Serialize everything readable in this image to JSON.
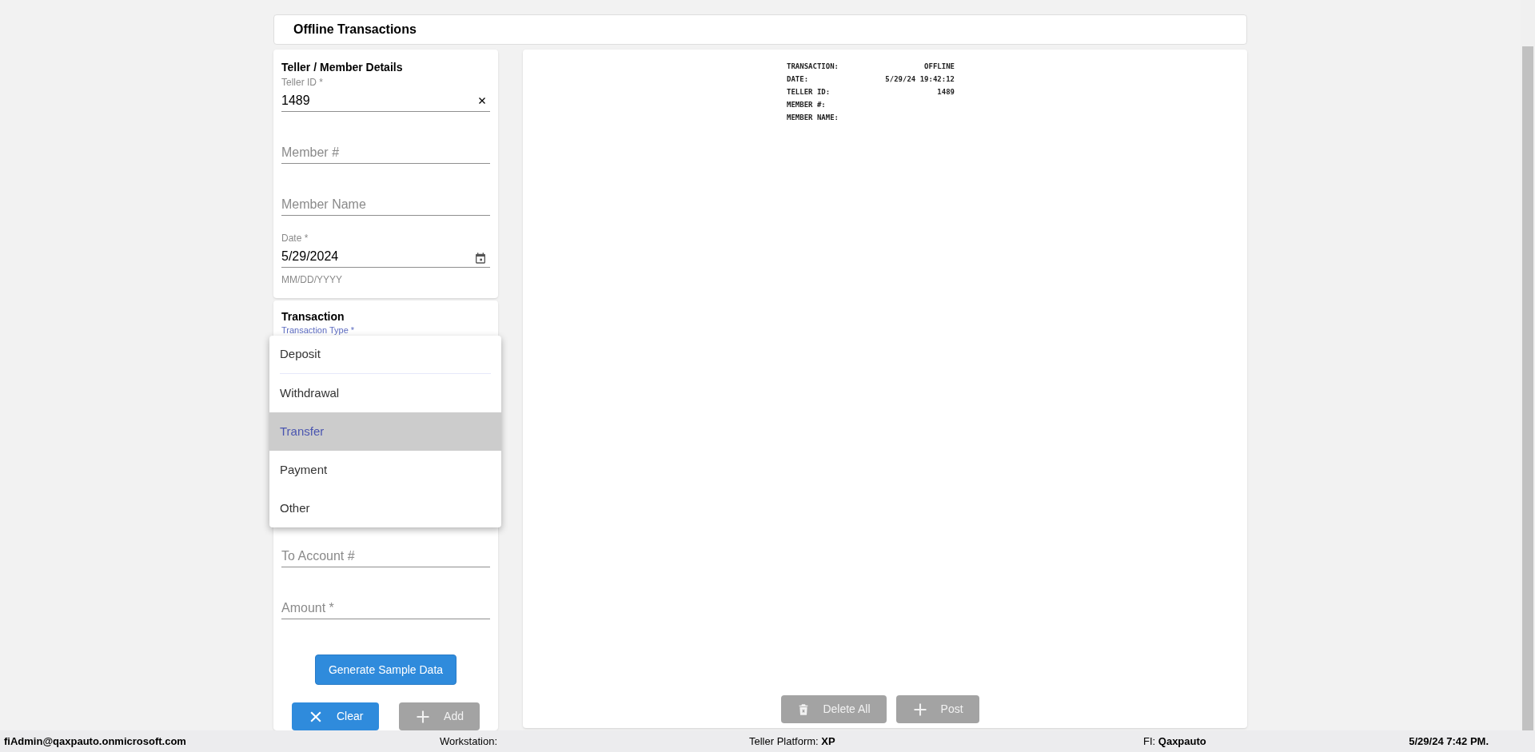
{
  "page_title": "Offline Transactions",
  "teller_member_details": {
    "title": "Teller / Member Details",
    "fields": [
      {
        "kind": "clearable",
        "label": "Teller ID *",
        "value": "1489"
      },
      {
        "kind": "plain",
        "placeholder": "Member #"
      },
      {
        "kind": "plain",
        "placeholder": "Member Name"
      },
      {
        "kind": "date",
        "label": "Date *",
        "value": "5/29/2024",
        "helper": "MM/DD/YYYY"
      }
    ]
  },
  "transaction": {
    "title": "Transaction",
    "type_label": "Transaction Type *",
    "menu": [
      {
        "label": "Deposit",
        "selected": false
      },
      {
        "label": "Withdrawal",
        "selected": false
      },
      {
        "label": "Transfer",
        "selected": true
      },
      {
        "label": "Payment",
        "selected": false
      },
      {
        "label": "Other",
        "selected": false
      }
    ],
    "fields": [
      {
        "placeholder": "To Account #"
      },
      {
        "placeholder": "Amount *"
      }
    ],
    "generate_button": {
      "label": "Generate Sample Data",
      "disabled": false
    },
    "buttons": [
      {
        "kind": "clear",
        "label": "Clear",
        "disabled": false
      },
      {
        "kind": "add",
        "label": "Add",
        "disabled": true
      }
    ]
  },
  "receipt": {
    "lines": [
      {
        "label": "TRANSACTION:",
        "value": "OFFLINE"
      },
      {
        "label": "DATE:",
        "value": "5/29/24 19:42:12"
      },
      {
        "label": "TELLER ID:",
        "value": "1489"
      },
      {
        "label": "MEMBER #:"
      },
      {
        "label": "MEMBER NAME:"
      }
    ],
    "buttons": [
      {
        "kind": "delete",
        "label": "Delete All",
        "disabled": true
      },
      {
        "kind": "add",
        "label": "Post",
        "disabled": true
      }
    ]
  },
  "status_bar": {
    "user": "fiAdmin@qaxpauto.onmicrosoft.com",
    "workstation_label": "Workstation:",
    "platform_label": "Teller Platform:",
    "platform_value": "XP",
    "fi_label": "FI:",
    "fi_value": "Qaxpauto",
    "datetime": "5/29/24 7:42 PM."
  }
}
